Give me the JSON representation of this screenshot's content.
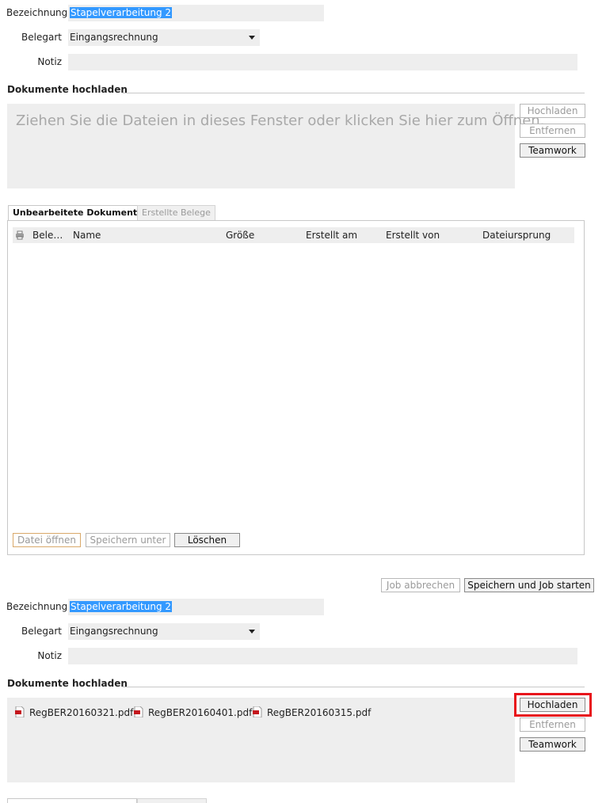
{
  "top_form": {
    "bezeichnung_label": "Bezeichnung",
    "bezeichnung_value": "Stapelverarbeitung 2",
    "belegart_label": "Belegart",
    "belegart_value": "Eingangsrechnung",
    "notiz_label": "Notiz",
    "notiz_value": ""
  },
  "upload_top": {
    "title": "Dokumente hochladen",
    "drop_hint": "Ziehen Sie die Dateien in dieses Fenster oder klicken Sie hier zum Öffnen.",
    "buttons": {
      "upload": "Hochladen",
      "remove": "Entfernen",
      "teamwork": "Teamwork"
    }
  },
  "tabs": [
    {
      "label": "Unbearbeitete Dokumente",
      "active": true
    },
    {
      "label": "Erstellte Belege",
      "active": false
    }
  ],
  "table": {
    "columns": [
      "Bele…",
      "Name",
      "Größe",
      "Erstellt am",
      "Erstellt von",
      "Dateiursprung"
    ],
    "rows": []
  },
  "panel_buttons": {
    "open": "Datei öffnen",
    "save_as": "Speichern unter",
    "delete": "Löschen"
  },
  "footer_buttons": {
    "cancel": "Job abbrechen",
    "save_start": "Speichern und Job starten"
  },
  "bottom_form": {
    "bezeichnung_label": "Bezeichnung",
    "bezeichnung_value": "Stapelverarbeitung 2",
    "belegart_label": "Belegart",
    "belegart_value": "Eingangsrechnung",
    "notiz_label": "Notiz",
    "notiz_value": ""
  },
  "upload_bottom": {
    "title": "Dokumente hochladen",
    "files": [
      {
        "name": "RegBER20160321.pdf",
        "icon": "pdf-icon"
      },
      {
        "name": "RegBER20160401.pdf",
        "icon": "pdf-icon"
      },
      {
        "name": "RegBER20160315.pdf",
        "icon": "pdf-icon"
      }
    ],
    "buttons": {
      "upload": "Hochladen",
      "remove": "Entfernen",
      "teamwork": "Teamwork"
    }
  },
  "colors": {
    "highlight": "#e8141b",
    "selection": "#3399ff",
    "field_bg": "#eeeeee"
  }
}
